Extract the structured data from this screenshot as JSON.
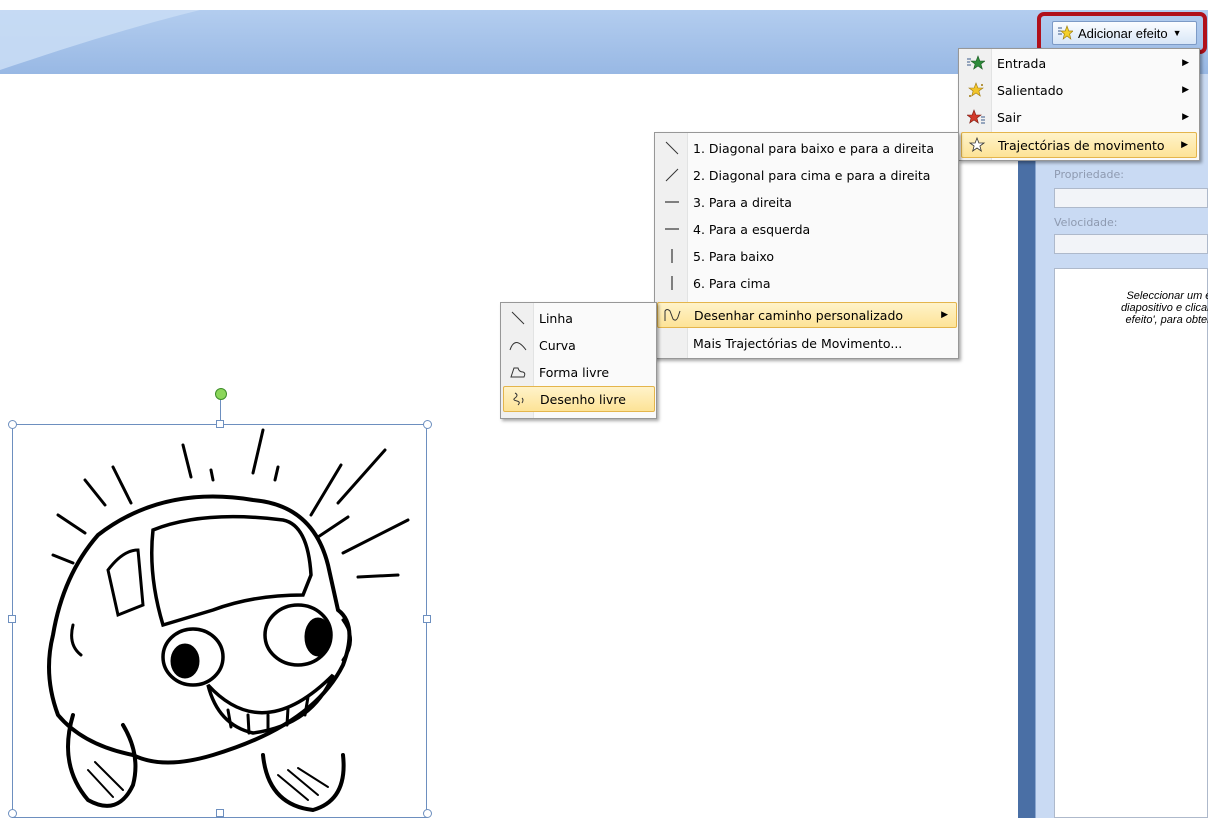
{
  "add_effect_button": {
    "label": "Adicionar efeito",
    "icon": "star-effect-icon"
  },
  "effect_menu": {
    "items": [
      {
        "label": "Entrada",
        "icon": "entrance-star-icon",
        "color": "#2e8b3a",
        "has_submenu": true
      },
      {
        "label": "Salientado",
        "icon": "emphasis-star-icon",
        "color": "#e8b820",
        "has_submenu": true
      },
      {
        "label": "Sair",
        "icon": "exit-star-icon",
        "color": "#d23a2a",
        "has_submenu": true
      },
      {
        "label": "Trajectórias de movimento",
        "icon": "motion-path-star-icon",
        "color": "#ffffff",
        "has_submenu": true,
        "highlighted": true
      }
    ]
  },
  "motion_path_menu": {
    "items": [
      {
        "label": "1. Diagonal para baixo e para a direita",
        "icon": "diagonal-down-right-icon"
      },
      {
        "label": "2. Diagonal para cima e para a direita",
        "icon": "diagonal-up-right-icon"
      },
      {
        "label": "3. Para a direita",
        "icon": "horizontal-line-icon"
      },
      {
        "label": "4. Para a esquerda",
        "icon": "horizontal-line-icon"
      },
      {
        "label": "5. Para baixo",
        "icon": "vertical-line-icon"
      },
      {
        "label": "6. Para cima",
        "icon": "vertical-line-icon"
      },
      {
        "label": "Desenhar caminho personalizado",
        "icon": "custom-path-icon",
        "has_submenu": true,
        "highlighted": true
      },
      {
        "label": "Mais Trajectórias de Movimento...",
        "icon": ""
      }
    ]
  },
  "custom_path_menu": {
    "items": [
      {
        "label": "Linha",
        "icon": "line-tool-icon"
      },
      {
        "label": "Curva",
        "icon": "curve-tool-icon"
      },
      {
        "label": "Forma livre",
        "icon": "freeform-tool-icon"
      },
      {
        "label": "Desenho livre",
        "icon": "scribble-tool-icon",
        "highlighted": true
      }
    ]
  },
  "task_pane": {
    "property_label": "Propriedade:",
    "speed_label": "Velocidade:",
    "hint": "Seleccionar um ele\ndiapositivo e clicar e\nefeito', para obter a"
  },
  "picture": {
    "description_icon": "smiling-car-clipart"
  },
  "colors": {
    "highlight": "#fde397",
    "ribbon": "#a3c0e8",
    "pane": "#4a6fa5",
    "red_frame": "#b0101b"
  }
}
